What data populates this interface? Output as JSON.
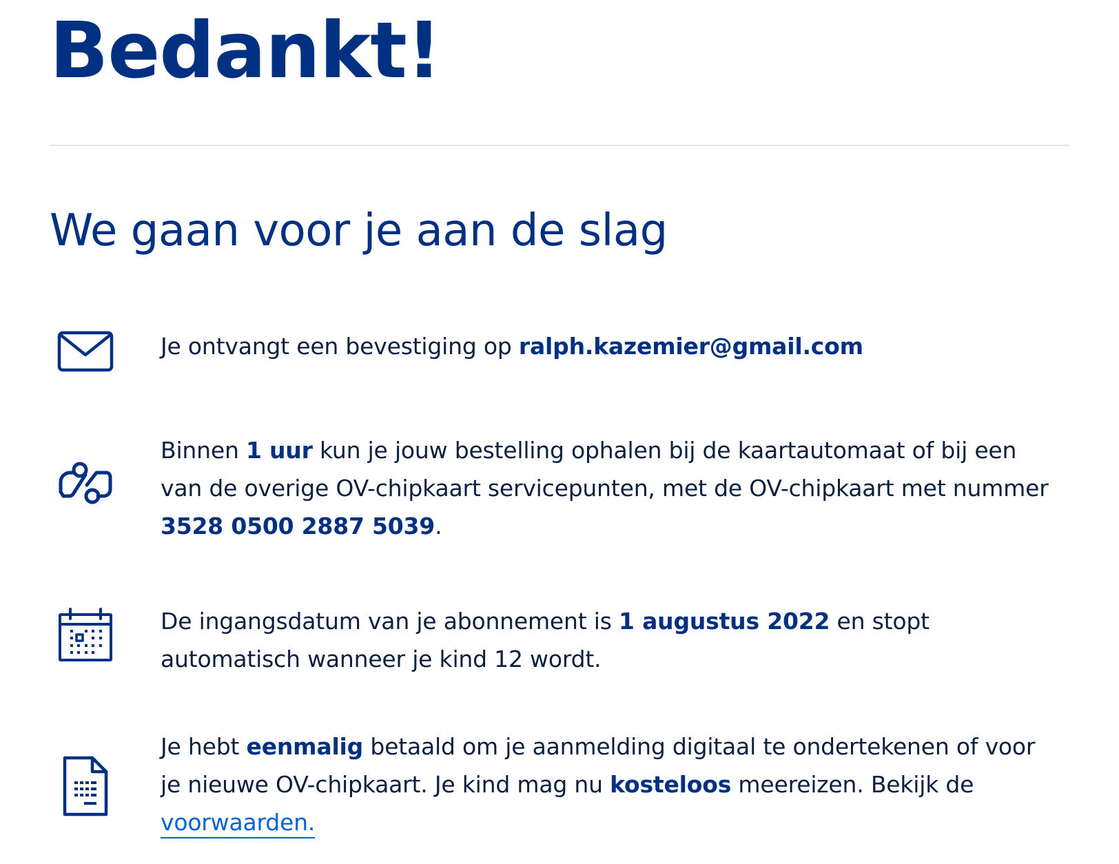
{
  "header": {
    "title": "Bedankt!",
    "subtitle": "We gaan voor je aan de slag"
  },
  "items": [
    {
      "icon": "envelope-icon",
      "prefix": "Je ontvangt een bevestiging op ",
      "email": "ralph.kazemier@gmail.com"
    },
    {
      "icon": "pickup-route-icon",
      "prefix": "Binnen ",
      "time": "1 uur",
      "middle": " kun je jouw bestelling ophalen bij de kaartautomaat of bij een van de overige OV-chipkaart servicepunten, met de OV-chipkaart met nummer ",
      "card_number": "3528 0500 2887 5039",
      "suffix": "."
    },
    {
      "icon": "calendar-icon",
      "prefix": "De ingangsdatum van je abonnement is ",
      "date": "1 augustus 2022",
      "suffix": " en stopt automatisch wanneer je kind 12 wordt."
    },
    {
      "icon": "document-icon",
      "prefix": "Je hebt ",
      "bold1": "eenmalig",
      "middle1": " betaald om je aanmelding digitaal te ondertekenen of voor je nieuwe OV-chipkaart. Je kind mag nu ",
      "bold2": "kosteloos",
      "middle2": " meereizen. Bekijk de ",
      "link_label": "voorwaarden."
    }
  ],
  "colors": {
    "brand_blue": "#003082",
    "body_text": "#0b1f3f",
    "link": "#0063d3",
    "divider": "#e3e5ea"
  }
}
